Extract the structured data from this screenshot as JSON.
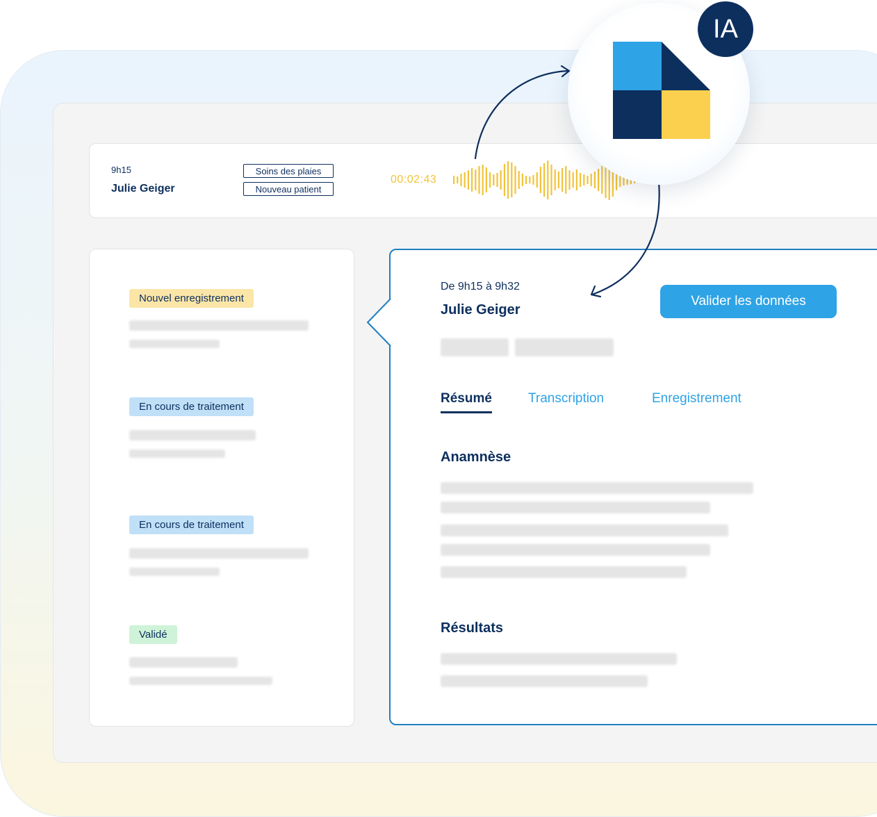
{
  "recording": {
    "time": "9h15",
    "patient_name": "Julie Geiger",
    "tags": [
      "Soins des plaies",
      "Nouveau patient"
    ],
    "timer": "00:02:43"
  },
  "list": {
    "items": [
      {
        "status": "Nouvel enregistrement",
        "status_type": "new"
      },
      {
        "status": "En cours de traitement",
        "status_type": "progress"
      },
      {
        "status": "En cours de traitement",
        "status_type": "progress"
      },
      {
        "status": "Validé",
        "status_type": "valid"
      }
    ]
  },
  "detail": {
    "time_range": "De 9h15 à 9h32",
    "patient_name": "Julie Geiger",
    "validate_label": "Valider les données",
    "tabs": [
      {
        "label": "Résumé",
        "active": true
      },
      {
        "label": "Transcription",
        "active": false
      },
      {
        "label": "Enregistrement",
        "active": false
      }
    ],
    "sections": [
      "Anamnèse",
      "Résultats"
    ]
  },
  "ai": {
    "badge": "IA",
    "logo_icon": "document-logo-icon"
  },
  "colors": {
    "navy": "#0d2f5e",
    "accent_blue": "#2ea3e6",
    "waveform_yellow": "#f2c33a",
    "badge_new": "#fbe6a8",
    "badge_progress": "#bfe0f7",
    "badge_valid": "#cff3d8"
  }
}
